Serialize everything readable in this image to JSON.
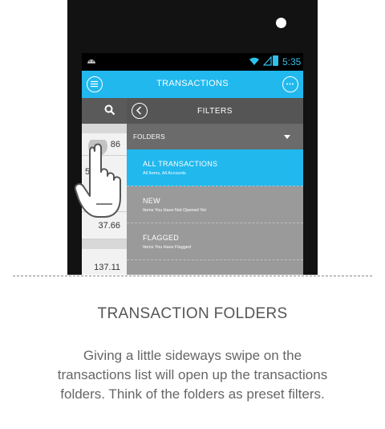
{
  "status_bar": {
    "time": "5:35"
  },
  "app_bar": {
    "title": "TRANSACTIONS"
  },
  "transaction_list": {
    "amounts": [
      "86",
      "5",
      "37.66",
      "137.11"
    ]
  },
  "filters_panel": {
    "title": "FILTERS",
    "folders_label": "FOLDERS",
    "items": [
      {
        "title": "ALL TRANSACTIONS",
        "subtitle": "All Items, All Accounts",
        "selected": true
      },
      {
        "title": "NEW",
        "subtitle": "Items You Have Not Opened Yet",
        "selected": false
      },
      {
        "title": "FLAGGED",
        "subtitle": "Items You Have Flagged",
        "selected": false
      }
    ]
  },
  "caption": {
    "heading": "TRANSACTION FOLDERS",
    "body": "Giving a little sideways swipe on the transactions list will open up the transactions folders. Think of the folders as preset filters."
  },
  "colors": {
    "accent": "#21b8ee",
    "panel": "#9a9a9a",
    "panel_header": "#555555"
  },
  "icons": [
    "android-icon",
    "wifi-icon",
    "signal-icon",
    "battery-icon",
    "menu-icon",
    "more-icon",
    "search-icon",
    "back-icon",
    "dropdown-arrow-icon",
    "hand-gesture-icon"
  ]
}
